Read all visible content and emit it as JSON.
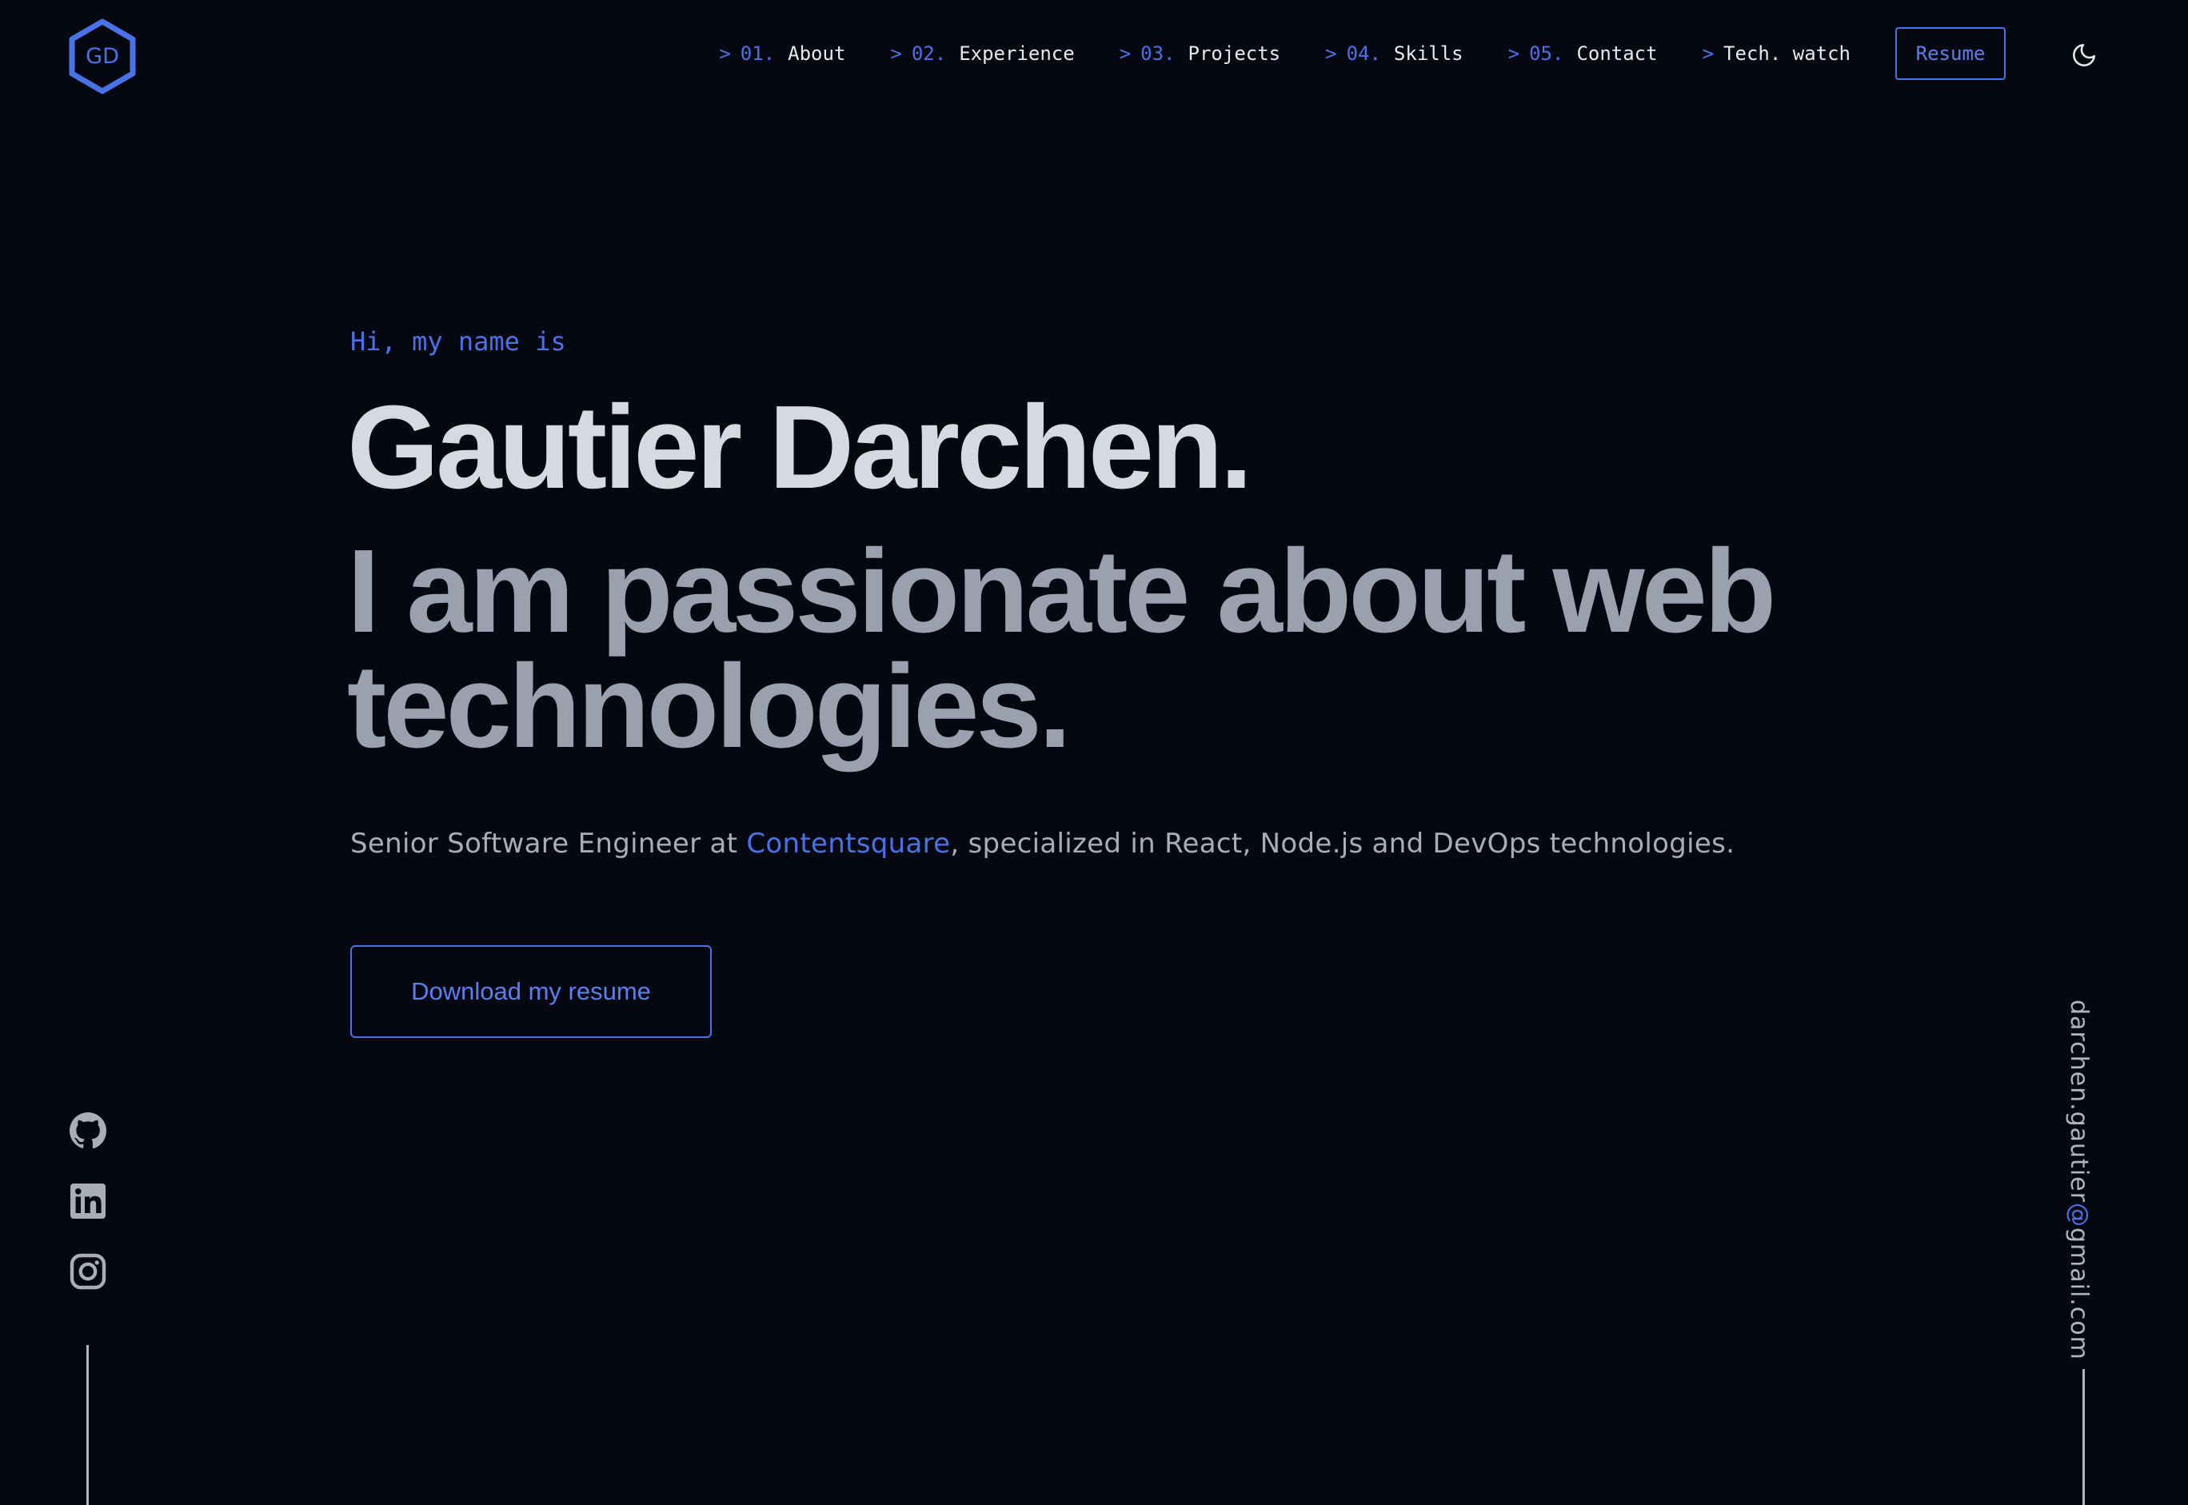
{
  "logo": {
    "initials": "GD"
  },
  "nav": {
    "items": [
      {
        "arrow": ">",
        "num": "01.",
        "label": "About"
      },
      {
        "arrow": ">",
        "num": "02.",
        "label": "Experience"
      },
      {
        "arrow": ">",
        "num": "03.",
        "label": "Projects"
      },
      {
        "arrow": ">",
        "num": "04.",
        "label": "Skills"
      },
      {
        "arrow": ">",
        "num": "05.",
        "label": "Contact"
      },
      {
        "arrow": ">",
        "label": "Tech. watch"
      }
    ],
    "resume_label": "Resume",
    "theme_icon": "moon-icon"
  },
  "hero": {
    "greeting": "Hi, my name is",
    "name": "Gautier Darchen.",
    "tagline": "I am passionate about web technologies.",
    "desc_before": "Senior Software Engineer at ",
    "desc_link": "Contentsquare",
    "desc_after": ", specialized in React, Node.js and DevOps technologies.",
    "download_label": "Download my resume"
  },
  "social": {
    "icons": [
      "github-icon",
      "linkedin-icon",
      "instagram-icon"
    ]
  },
  "email": {
    "user": "darchen.gautier",
    "at": "@",
    "domain": "gmail.com"
  },
  "colors": {
    "background": "#050811",
    "accent": "#4a72e8",
    "name": "#d6d9e0",
    "tagline": "#9aa0ad",
    "text": "#a8adb8"
  }
}
